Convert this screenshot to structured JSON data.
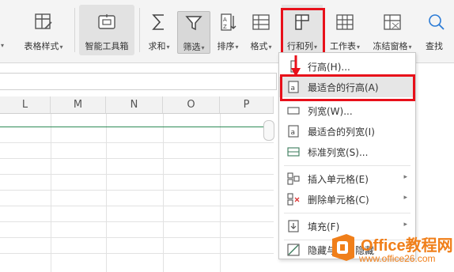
{
  "ribbon": {
    "items": [
      {
        "label": "表格样式"
      },
      {
        "label": "智能工具箱"
      },
      {
        "label": "求和"
      },
      {
        "label": "筛选"
      },
      {
        "label": "排序"
      },
      {
        "label": "格式"
      },
      {
        "label": "行和列"
      },
      {
        "label": "工作表"
      },
      {
        "label": "冻结窗格"
      },
      {
        "label": "查找"
      }
    ]
  },
  "columns": [
    "L",
    "M",
    "N",
    "O",
    "P"
  ],
  "menu": {
    "items": [
      {
        "label": "行高(H)...",
        "icon": "row-height-icon"
      },
      {
        "label": "最适合的行高(A)",
        "icon": "best-fit-row-height-icon"
      },
      {
        "label": "列宽(W)...",
        "icon": "column-width-icon"
      },
      {
        "label": "最适合的列宽(I)",
        "icon": "best-fit-column-width-icon"
      },
      {
        "label": "标准列宽(S)...",
        "icon": "standard-column-width-icon"
      },
      {
        "label": "插入单元格(E)",
        "icon": "insert-cells-icon"
      },
      {
        "label": "删除单元格(C)",
        "icon": "delete-cells-icon"
      },
      {
        "label": "填充(F)",
        "icon": "fill-icon"
      },
      {
        "label": "隐藏与取消隐藏",
        "icon": "hide-unhide-icon"
      }
    ]
  },
  "watermark": {
    "title": "Office教程网",
    "url": "www.office26.com"
  },
  "colors": {
    "highlight_red": "#e8101a",
    "watermark_orange": "#f07f1a",
    "grid_green": "#2e8b57"
  }
}
